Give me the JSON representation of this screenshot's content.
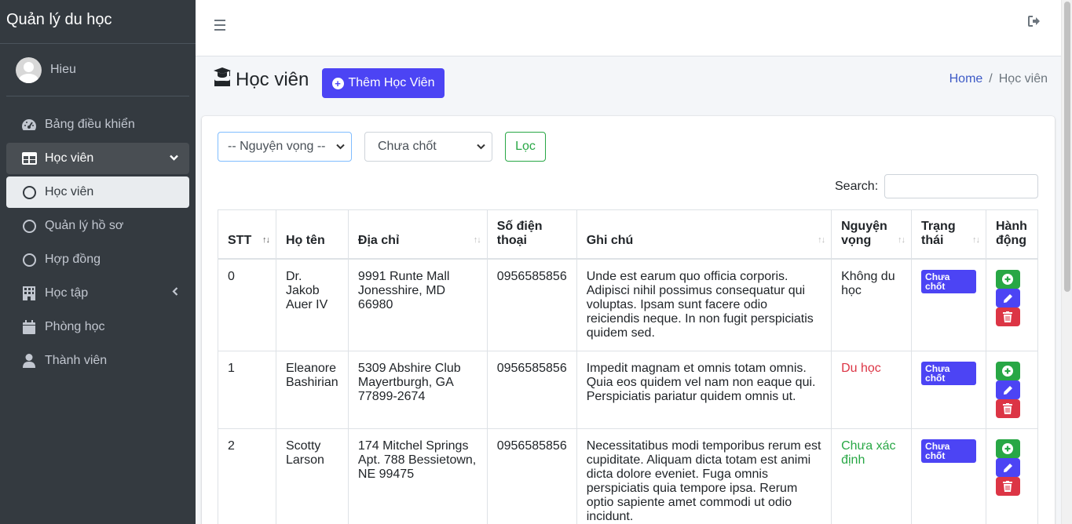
{
  "sidebar": {
    "brand": "Quản lý du học",
    "user": "Hieu",
    "items": [
      {
        "label": "Bảng điều khiển",
        "icon": "dashboard-icon"
      },
      {
        "label": "Học viên",
        "icon": "table-icon"
      },
      {
        "label": "Học viên",
        "icon": "circle-icon"
      },
      {
        "label": "Quản lý hồ sơ",
        "icon": "circle-icon"
      },
      {
        "label": "Hợp đồng",
        "icon": "circle-icon"
      },
      {
        "label": "Học tập",
        "icon": "building-icon"
      },
      {
        "label": "Phòng học",
        "icon": "calendar-icon"
      },
      {
        "label": "Thành viên",
        "icon": "user-icon"
      }
    ]
  },
  "header": {
    "title": "Học viên",
    "add_button": "Thêm Học Viên",
    "breadcrumb": {
      "home": "Home",
      "separator": "/",
      "current": "Học viên"
    }
  },
  "filters": {
    "nguyen_vong": "-- Nguyện vọng --",
    "trang_thai": "Chưa chốt",
    "filter_button": "Lọc",
    "search_label": "Search:"
  },
  "table": {
    "columns": [
      "STT",
      "Họ tên",
      "Địa chỉ",
      "Số điện thoại",
      "Ghi chú",
      "Nguyện vọng",
      "Trạng thái",
      "Hành động"
    ],
    "rows": [
      {
        "stt": "0",
        "name": "Dr. Jakob Auer IV",
        "address": "9991 Runte Mall Jonesshire, MD 66980",
        "phone": "0956585856",
        "note": "Unde est earum quo officia corporis. Adipisci nihil possimus consequatur qui voluptas. Ipsam sunt facere odio reiciendis neque. In non fugit perspiciatis quidem sed.",
        "wish": "Không du học",
        "status": "Chưa chốt"
      },
      {
        "stt": "1",
        "name": "Eleanore Bashirian",
        "address": "5309 Abshire Club Mayertburgh, GA 77899-2674",
        "phone": "0956585856",
        "note": "Impedit magnam et omnis totam omnis. Quia eos quidem vel nam non eaque qui. Perspiciatis pariatur quidem omnis ut.",
        "wish": "Du học",
        "status": "Chưa chốt"
      },
      {
        "stt": "2",
        "name": "Scotty Larson",
        "address": "174 Mitchel Springs Apt. 788 Bessietown, NE 99475",
        "phone": "0956585856",
        "note": "Necessitatibus modi temporibus rerum est cupiditate. Aliquam dicta totam est animi dicta dolore eveniet. Fuga omnis perspiciatis quia tempore ipsa. Rerum optio sapiente amet commodi ut odio incidunt.",
        "wish": "Chưa xác định",
        "status": "Chưa chốt"
      }
    ]
  },
  "colors": {
    "sidebar_bg": "#343a40",
    "primary": "#4c44f4",
    "success": "#28a745",
    "danger": "#dc3545"
  }
}
